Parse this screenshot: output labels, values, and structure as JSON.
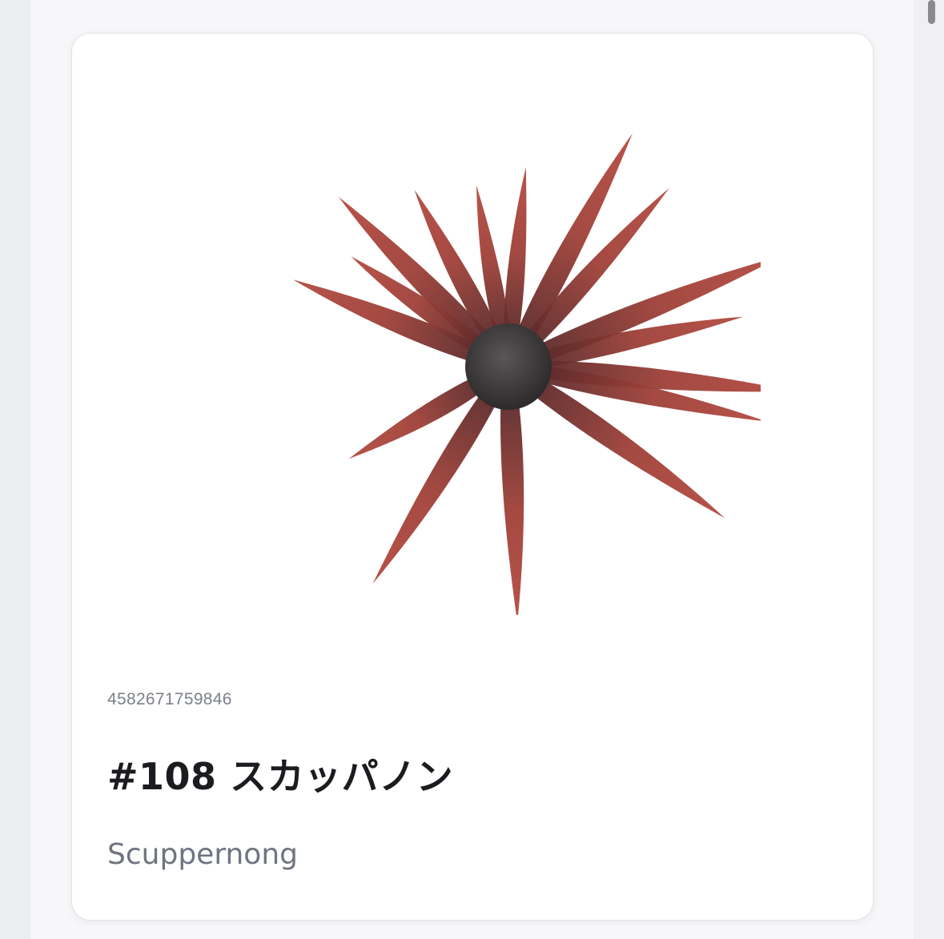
{
  "product": {
    "sku": "4582671759846",
    "title": "#108 スカッパノン",
    "color_name": "Scuppernong",
    "image_icon": "soft-lure-octopus-skirt-image"
  },
  "colors": {
    "lure_body": "#9a3b34",
    "lure_head": "#3e3b3c",
    "card_background": "#ffffff",
    "page_background": "#f7f7f9"
  }
}
